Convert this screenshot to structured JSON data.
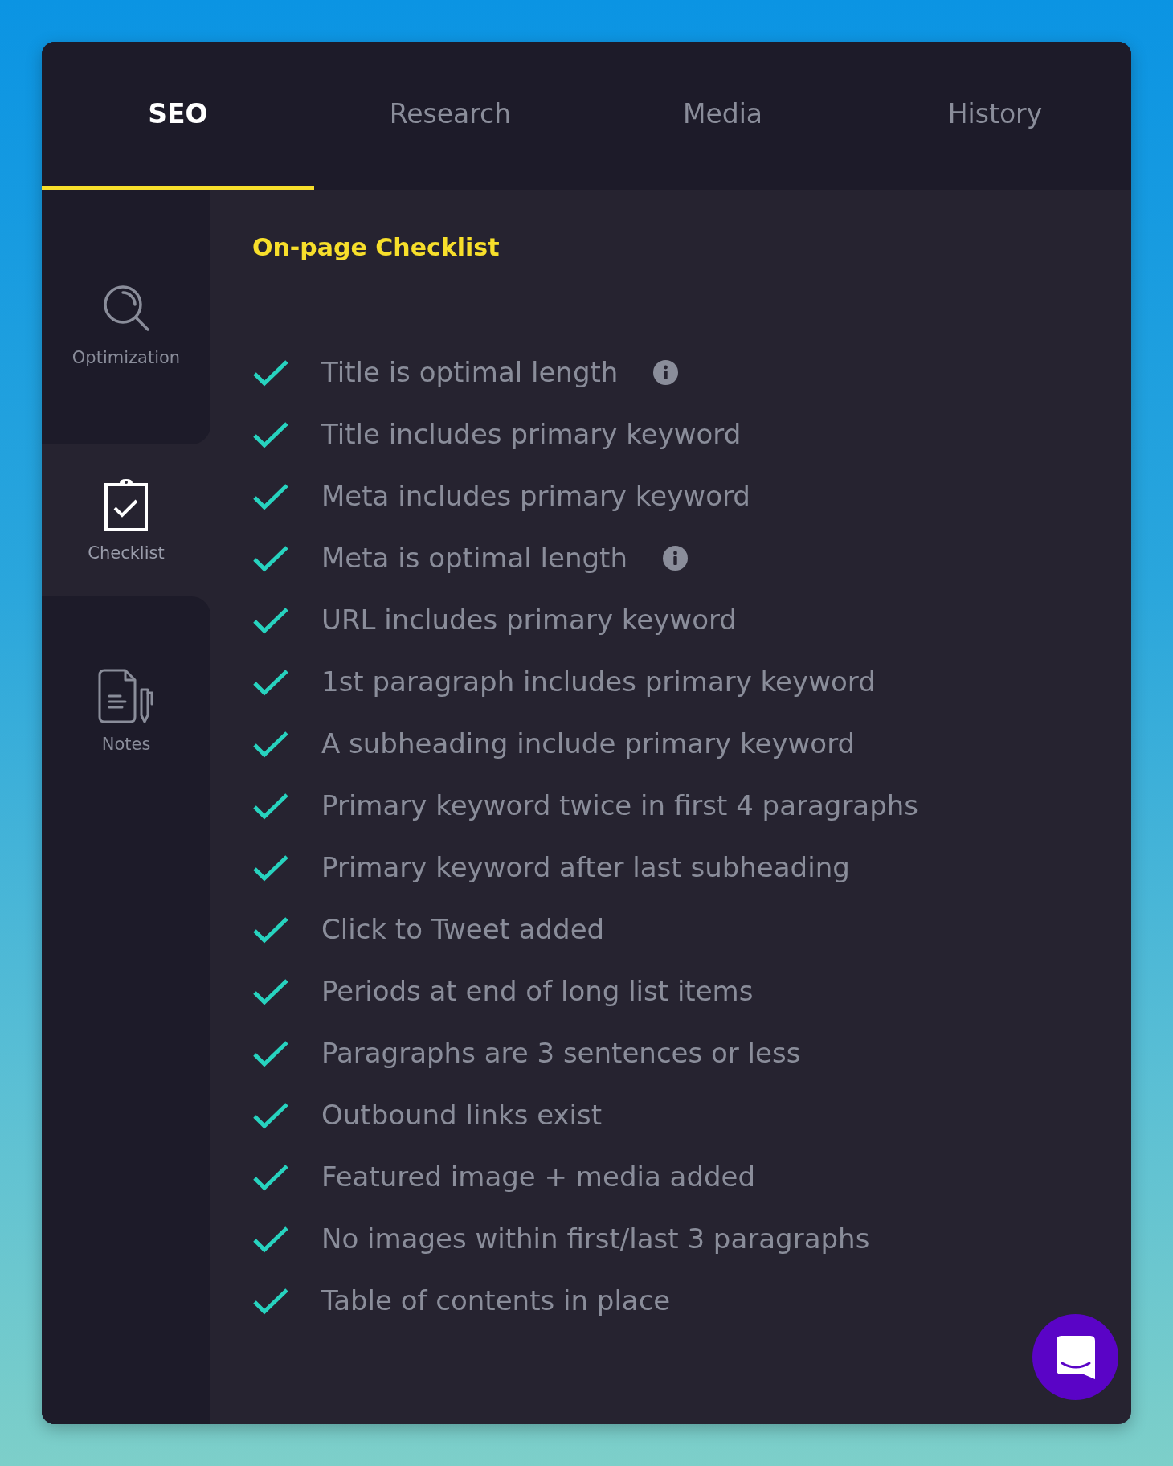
{
  "tabs": [
    {
      "label": "SEO",
      "selected": true
    },
    {
      "label": "Research",
      "selected": false
    },
    {
      "label": "Media",
      "selected": false
    },
    {
      "label": "History",
      "selected": false
    }
  ],
  "sidebar": {
    "items": [
      {
        "label": "Optimization",
        "selected": false
      },
      {
        "label": "Checklist",
        "selected": true
      },
      {
        "label": "Notes",
        "selected": false
      }
    ]
  },
  "checklist": {
    "title": "On-page Checklist",
    "items": [
      {
        "label": "Title is optimal length",
        "checked": true,
        "has_info": true
      },
      {
        "label": "Title includes primary keyword",
        "checked": true
      },
      {
        "label": "Meta includes primary keyword",
        "checked": true
      },
      {
        "label": "Meta is optimal length",
        "checked": true,
        "has_info": true
      },
      {
        "label": "URL includes primary keyword",
        "checked": true
      },
      {
        "label": "1st paragraph includes primary keyword",
        "checked": true
      },
      {
        "label": "A subheading include primary keyword",
        "checked": true
      },
      {
        "label": "Primary keyword twice in first 4 paragraphs",
        "checked": true
      },
      {
        "label": "Primary keyword after last subheading",
        "checked": true
      },
      {
        "label": "Click to Tweet added",
        "checked": true
      },
      {
        "label": "Periods at end of long list items",
        "checked": true
      },
      {
        "label": "Paragraphs are 3 sentences or less",
        "checked": true
      },
      {
        "label": "Outbound links exist",
        "checked": true
      },
      {
        "label": "Featured image + media added",
        "checked": true
      },
      {
        "label": "No images within first/last 3 paragraphs",
        "checked": true
      },
      {
        "label": "Table of contents in place",
        "checked": true
      }
    ]
  }
}
